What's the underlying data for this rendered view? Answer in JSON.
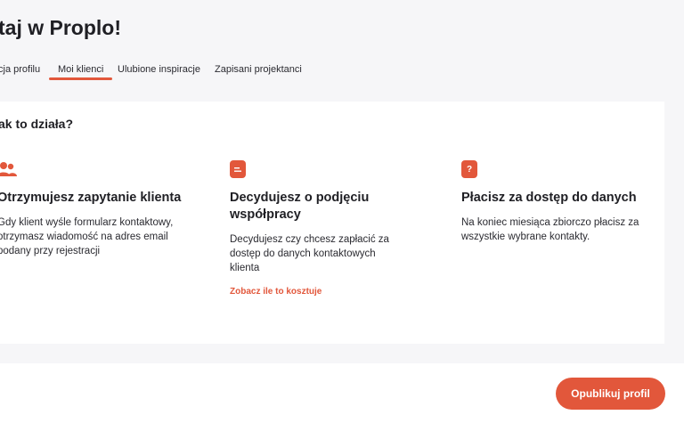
{
  "page": {
    "title": "taj w Proplo!"
  },
  "tabs": [
    {
      "label": "cja profilu"
    },
    {
      "label": "Moi klienci",
      "active": true
    },
    {
      "label": "Ulubione inspiracje"
    },
    {
      "label": "Zapisani projektanci"
    }
  ],
  "how": {
    "title": "ak to działa?",
    "columns": [
      {
        "icon": "users-icon",
        "heading": "Otrzymujesz zapytanie klienta",
        "text": "Gdy klient wyśle formularz kontaktowy, otrzymasz wiadomość na adres email podany przy rejestracji"
      },
      {
        "icon": "document-icon",
        "heading": "Decydujesz o podjęciu współpracy",
        "text": "Decydujesz czy chcesz zapłacić za dostęp do danych kontaktowych klienta",
        "link": "Zobacz ile to kosztuje"
      },
      {
        "icon": "question-bubble-icon",
        "heading": "Płacisz za dostęp do danych",
        "text": "Na koniec miesiąca zbiorczo płacisz za wszystkie wybrane kontakty."
      }
    ]
  },
  "footer": {
    "publish_label": "Opublikuj profil"
  },
  "colors": {
    "accent": "#e2573b",
    "background": "#f6f6f8"
  }
}
